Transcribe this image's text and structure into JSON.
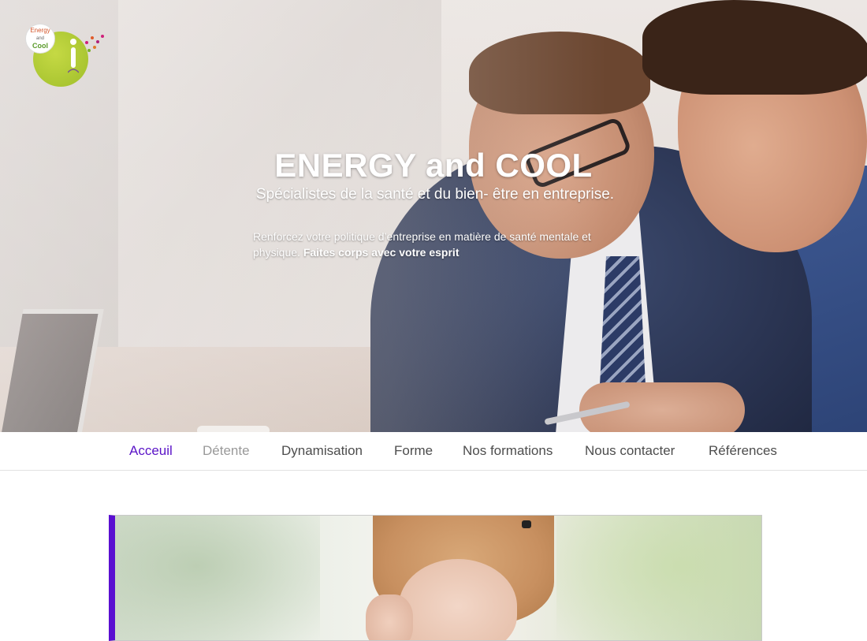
{
  "hero": {
    "title": "ENERGY and COOL",
    "subtitle": "Spécialistes de la santé et du bien- être en entreprise.",
    "text": "Renforcez votre politique d’entreprise en matière de santé mentale et physique.",
    "text_bold": "Faites corps avec votre esprit"
  },
  "logo": {
    "line1": "Energy",
    "line2": "and",
    "line3": "Cool"
  },
  "nav": {
    "items": [
      {
        "label": "Acceuil",
        "state": "active"
      },
      {
        "label": "Détente",
        "state": "muted"
      },
      {
        "label": "Dynamisation",
        "state": "normal"
      },
      {
        "label": "Forme",
        "state": "normal"
      },
      {
        "label": "Nos formations",
        "state": "normal"
      },
      {
        "label": "Nous contacter",
        "state": "normal"
      },
      {
        "label": "Références",
        "state": "normal"
      }
    ]
  },
  "colors": {
    "accent": "#5a13c7",
    "nav_text": "#4d4d4d",
    "nav_muted": "#999999",
    "logo_green": "#9fbe2a"
  }
}
